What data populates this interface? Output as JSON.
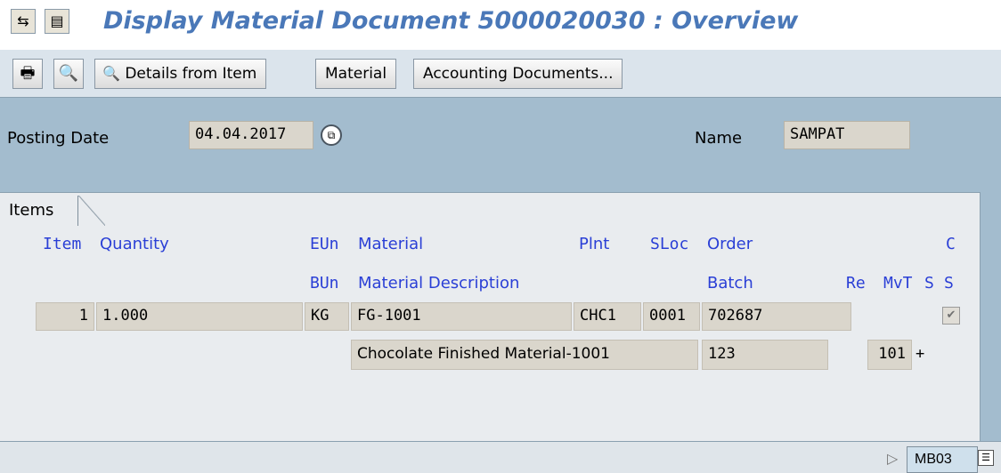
{
  "title": "Display Material Document 5000020030 : Overview",
  "toolbar": {
    "details_label": "Details from Item",
    "material_label": "Material",
    "accounting_label": "Accounting Documents..."
  },
  "header": {
    "posting_date_label": "Posting Date",
    "posting_date_value": "04.04.2017",
    "name_label": "Name",
    "name_value": "SAMPAT"
  },
  "items_tab": "Items",
  "columns": {
    "item": "Item",
    "quantity": "Quantity",
    "eun": "EUn",
    "material": "Material",
    "plnt": "Plnt",
    "sloc": "SLoc",
    "order": "Order",
    "c": "C",
    "bun": "BUn",
    "material_description": "Material Description",
    "batch": "Batch",
    "re": "Re",
    "mvt": "MvT",
    "s1": "S",
    "s2": "S"
  },
  "row": {
    "item": "1",
    "quantity": "1.000",
    "eun": "KG",
    "material": "FG-1001",
    "plnt": "CHC1",
    "sloc": "0001",
    "order": "702687",
    "description": "Chocolate Finished Material-1001",
    "batch": "123",
    "mvt": "101",
    "sign": "+",
    "check": "✔"
  },
  "status": {
    "transaction": "MB03"
  }
}
